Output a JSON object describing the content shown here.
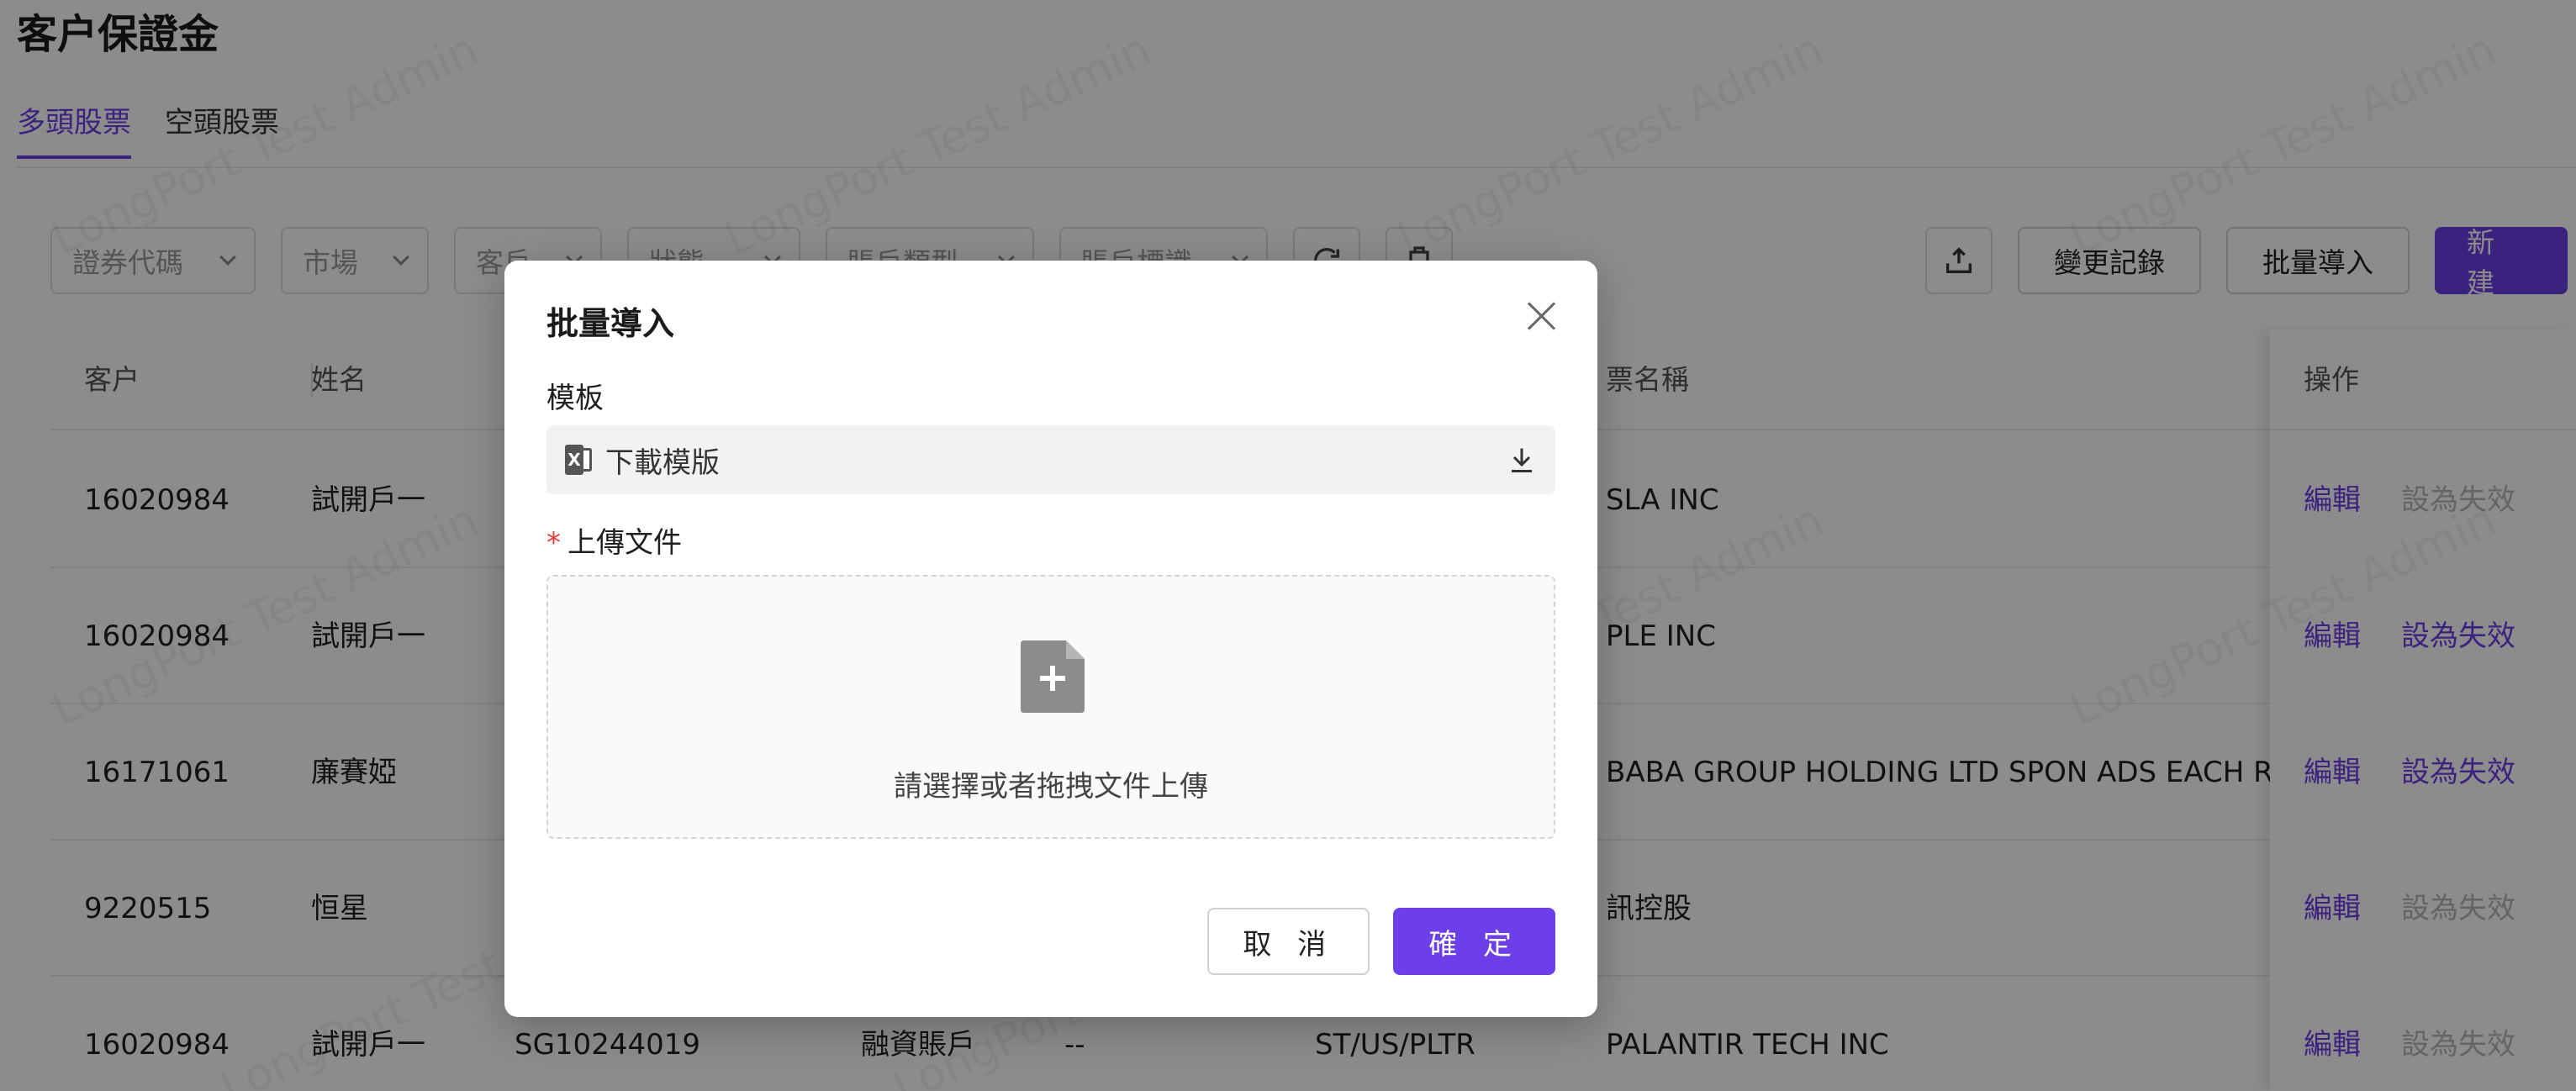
{
  "page": {
    "title": "客户保證金",
    "tabs": [
      {
        "label": "多頭股票",
        "active": true
      },
      {
        "label": "空頭股票",
        "active": false
      }
    ]
  },
  "filters": [
    {
      "placeholder": "證券代碼"
    },
    {
      "placeholder": "市場"
    },
    {
      "placeholder": "客戶"
    },
    {
      "placeholder": "狀態"
    },
    {
      "placeholder": "賬戶類型"
    },
    {
      "placeholder": "賬戶標識"
    }
  ],
  "toolbar": {
    "refresh_icon": "refresh-icon",
    "settings_icon": "settings-icon",
    "export_icon": "export-icon",
    "change_log_label": "變更記錄",
    "batch_import_label": "批量導入",
    "new_label": "新 建"
  },
  "table": {
    "columns": {
      "client": "客户",
      "name": "姓名",
      "stock_name": "票名稱",
      "ops": "操作"
    },
    "rows": [
      {
        "client": "16020984",
        "name": "試開戶一",
        "account": "",
        "type": "",
        "extra": "",
        "code": "",
        "stock_name": "SLA INC",
        "edit": "編輯",
        "deactivate": "設為失效",
        "deactivate_enabled": false
      },
      {
        "client": "16020984",
        "name": "試開戶一",
        "account": "",
        "type": "",
        "extra": "",
        "code": "",
        "stock_name": "PLE INC",
        "edit": "編輯",
        "deactivate": "設為失效",
        "deactivate_enabled": true
      },
      {
        "client": "16171061",
        "name": "廉賽婭",
        "account": "",
        "type": "",
        "extra": "",
        "code": "",
        "stock_name": "BABA GROUP HOLDING LTD SPON ADS EACH REP",
        "edit": "編輯",
        "deactivate": "設為失效",
        "deactivate_enabled": true
      },
      {
        "client": "9220515",
        "name": "恒星",
        "account": "",
        "type": "",
        "extra": "",
        "code": "",
        "stock_name": "訊控股",
        "edit": "編輯",
        "deactivate": "設為失效",
        "deactivate_enabled": false
      },
      {
        "client": "16020984",
        "name": "試開戶一",
        "account": "SG10244019",
        "type": "融資賬戶",
        "extra": "--",
        "code": "ST/US/PLTR",
        "stock_name": "PALANTIR TECH INC",
        "edit": "編輯",
        "deactivate": "設為失效",
        "deactivate_enabled": false
      }
    ]
  },
  "watermark": "LongPort Test Admin",
  "modal": {
    "title": "批量導入",
    "template_label": "模板",
    "template_file": "下載模版",
    "template_file_icon": "excel-file-icon",
    "download_icon": "download-icon",
    "upload_label": "上傳文件",
    "upload_required_mark": "*",
    "upload_icon": "file-add-icon",
    "upload_hint": "請選擇或者拖拽文件上傳",
    "cancel_label": "取 消",
    "ok_label": "確 定"
  },
  "colors": {
    "accent": "#6c3fe8",
    "required": "#e53935",
    "mask": "rgba(0,0,0,0.45)"
  }
}
